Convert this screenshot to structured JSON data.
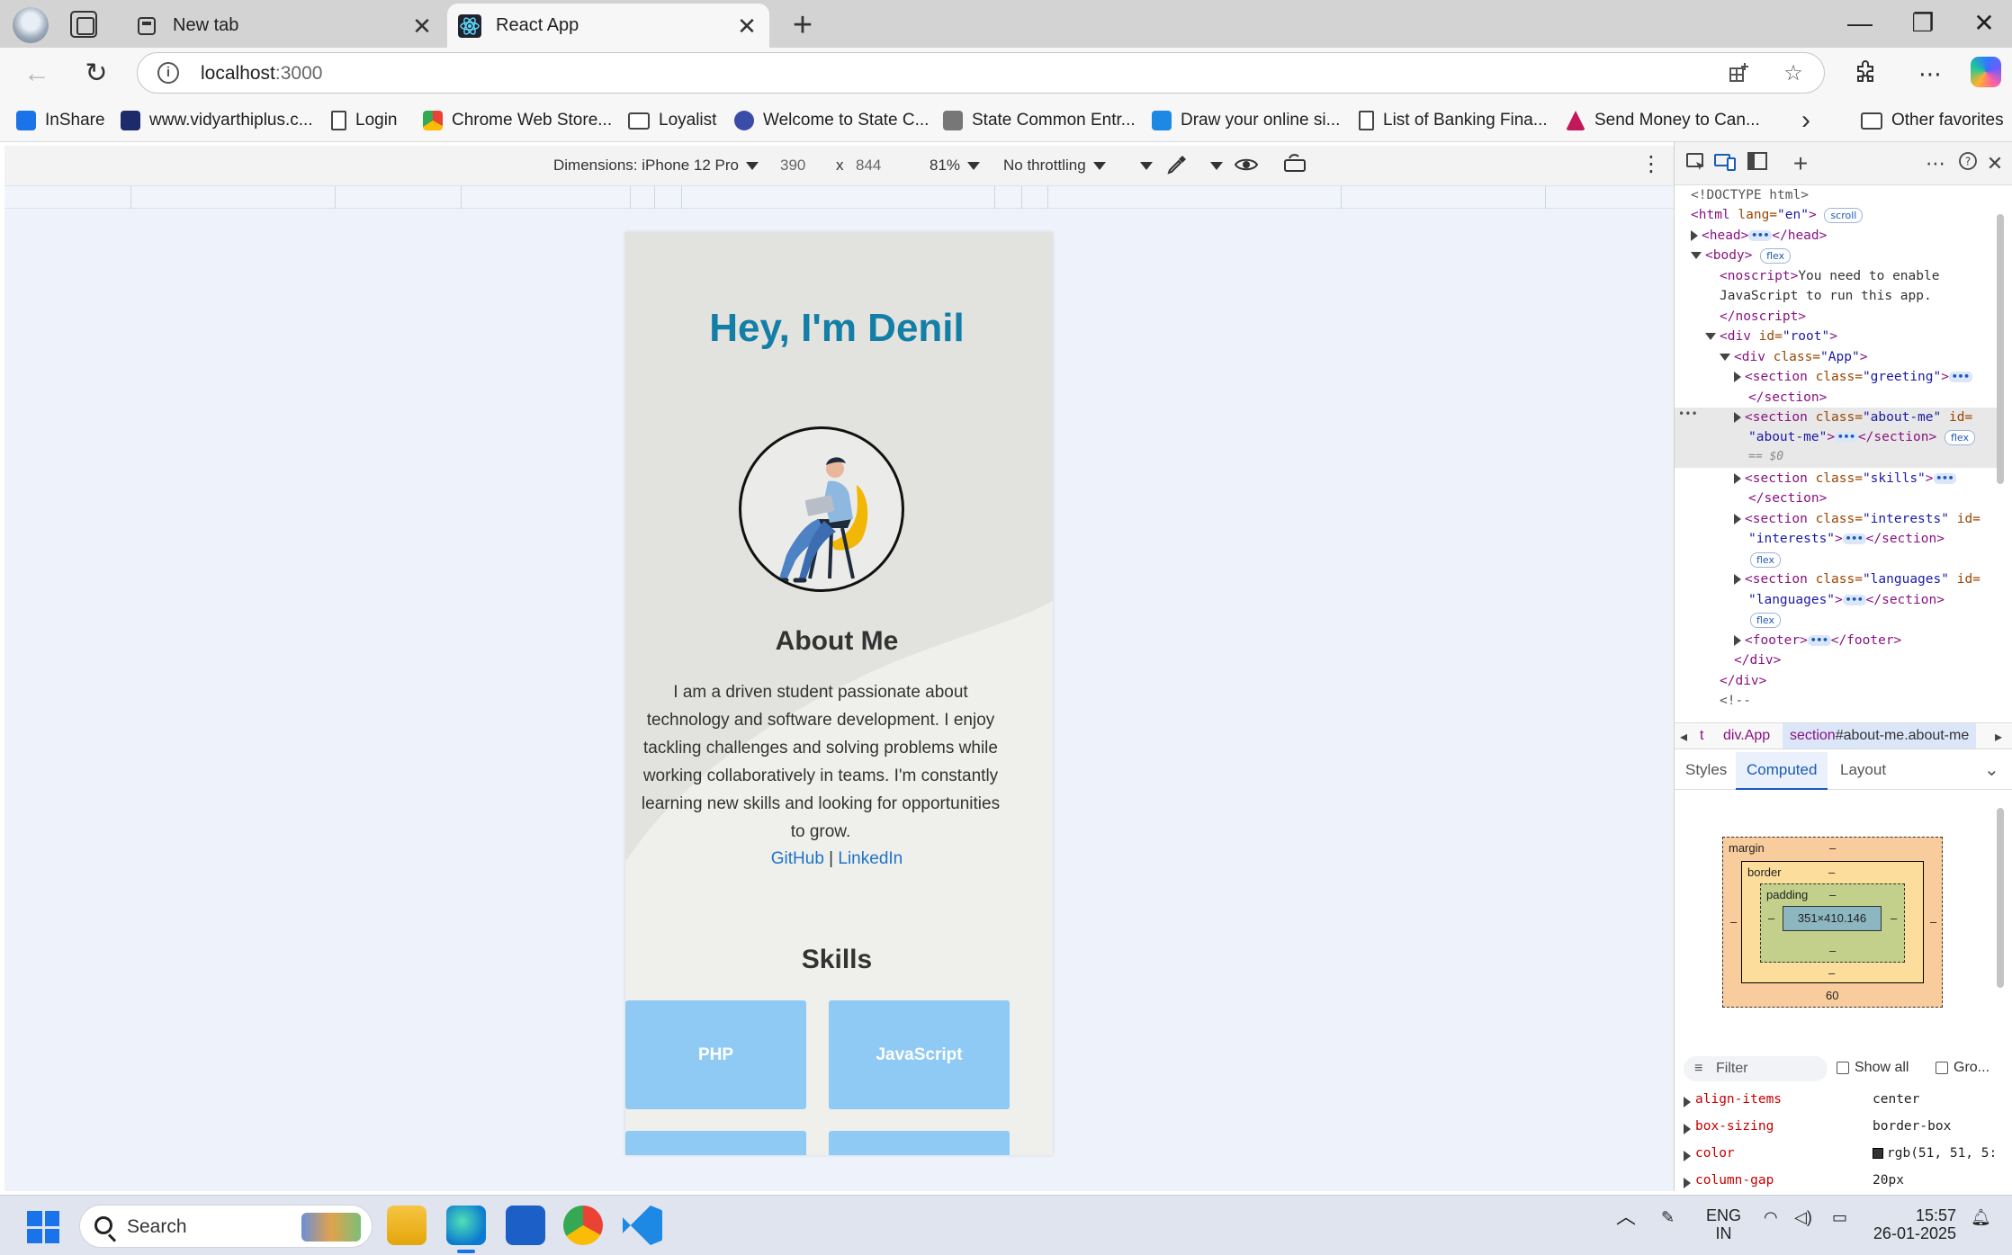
{
  "browser": {
    "tabs": [
      {
        "label": "New tab"
      },
      {
        "label": "React App"
      }
    ],
    "new_tab": "+",
    "window_controls": {
      "minimize": "—",
      "restore": "❐",
      "close": "✕"
    },
    "nav": {
      "back": "←",
      "reload": "↻"
    },
    "address": {
      "host": "localhost",
      "port": ":3000"
    },
    "toolbar_icons": [
      "apps-icon",
      "favorite-star-icon",
      "extensions-icon",
      "more-icon",
      "copilot-icon"
    ]
  },
  "favorites": {
    "items": [
      {
        "label": "InShare",
        "color": "#1a73e8"
      },
      {
        "label": "www.vidyarthiplus.c...",
        "color": "#1d2b6b"
      },
      {
        "label": "Login",
        "icon": "doc"
      },
      {
        "label": "Chrome Web Store...",
        "color": "#ea4335"
      },
      {
        "label": "Loyalist",
        "icon": "folder"
      },
      {
        "label": "Welcome to State C...",
        "color": "#3b4ba8"
      },
      {
        "label": "State Common Entr...",
        "color": "#777777"
      },
      {
        "label": "Draw your online si...",
        "color": "#1e88e5"
      },
      {
        "label": "List of Banking Fina...",
        "icon": "doc"
      },
      {
        "label": "Send Money to Can...",
        "color": "#c2185b"
      }
    ],
    "other": "Other favorites"
  },
  "device_toolbar": {
    "dimensions": "Dimensions: iPhone 12 Pro",
    "width": "390",
    "times": "x",
    "height": "844",
    "zoom": "81%",
    "throttling": "No throttling"
  },
  "page": {
    "greeting": "Hey, I'm Denil",
    "about_title": "About Me",
    "about_text": "I am a driven student passionate about technology and software development. I enjoy tackling challenges and solving problems while working collaboratively in teams. I'm constantly learning new skills and looking for opportunities to grow.",
    "links": {
      "github": "GitHub",
      "sep": " | ",
      "linkedin": "LinkedIn"
    },
    "skills_title": "Skills",
    "skills": [
      "PHP",
      "JavaScript",
      "",
      ""
    ],
    "colors": {
      "greeting": "#137ea6",
      "skill_tile": "#8fcaf4",
      "link": "#1f73c8"
    }
  },
  "devtools": {
    "dom": {
      "doctype": "<!DOCTYPE html>",
      "html_open": "<html",
      "lang_attr": " lang=",
      "lang_val": "\"en\"",
      "close_bracket": ">",
      "scroll_pill": "scroll",
      "head_open": "<head>",
      "head_close": "</head>",
      "body_open": "<body>",
      "flex_pill": "flex",
      "noscript_open": "<noscript>",
      "noscript_text_1": "You need to enable",
      "noscript_text_2": "JavaScript to run this app.",
      "noscript_close": "</noscript>",
      "div_open": "<div",
      "id_attr": " id=",
      "root_val": "\"root\"",
      "class_attr": " class=",
      "app_val": "\"App\"",
      "section_open": "<section",
      "greeting_val": "\"greeting\"",
      "section_close": "</section>",
      "aboutme_val": "\"about-me\"",
      "id_attr_trail": " id=",
      "aboutme_id": "\"about-me\"",
      "eq_sel": "== $0",
      "skills_val": "\"skills\"",
      "interests_val": "\"interests\"",
      "interests_id": "\"interests\"",
      "languages_val": "\"languages\"",
      "languages_id": "\"languages\"",
      "footer_open": "<footer>",
      "footer_close": "</footer>",
      "div_close": "</div>",
      "comment": "<!--",
      "ellipsis": "•••",
      "row_dots": "•••"
    },
    "breadcrumbs": {
      "prev": "t",
      "div": "div.App",
      "section_tag": "section",
      "section_rest": "#about-me.about-me"
    },
    "pane_tabs": [
      "Styles",
      "Computed",
      "Layout"
    ],
    "box_model": {
      "margin": "margin",
      "border": "border",
      "padding": "padding",
      "content": "351×410.146",
      "dash": "–",
      "margin_bottom": "60"
    },
    "filter_placeholder": "Filter",
    "show_all": "Show all",
    "group": "Gro...",
    "computed": [
      {
        "name": "align-items",
        "value": "center"
      },
      {
        "name": "box-sizing",
        "value": "border-box"
      },
      {
        "name": "color",
        "value": "rgb(51, 51, 5:"
      },
      {
        "name": "column-gap",
        "value": "20px"
      }
    ]
  },
  "taskbar": {
    "search": "Search",
    "lang_1": "ENG",
    "lang_2": "IN",
    "time": "15:57",
    "date": "26-01-2025"
  }
}
